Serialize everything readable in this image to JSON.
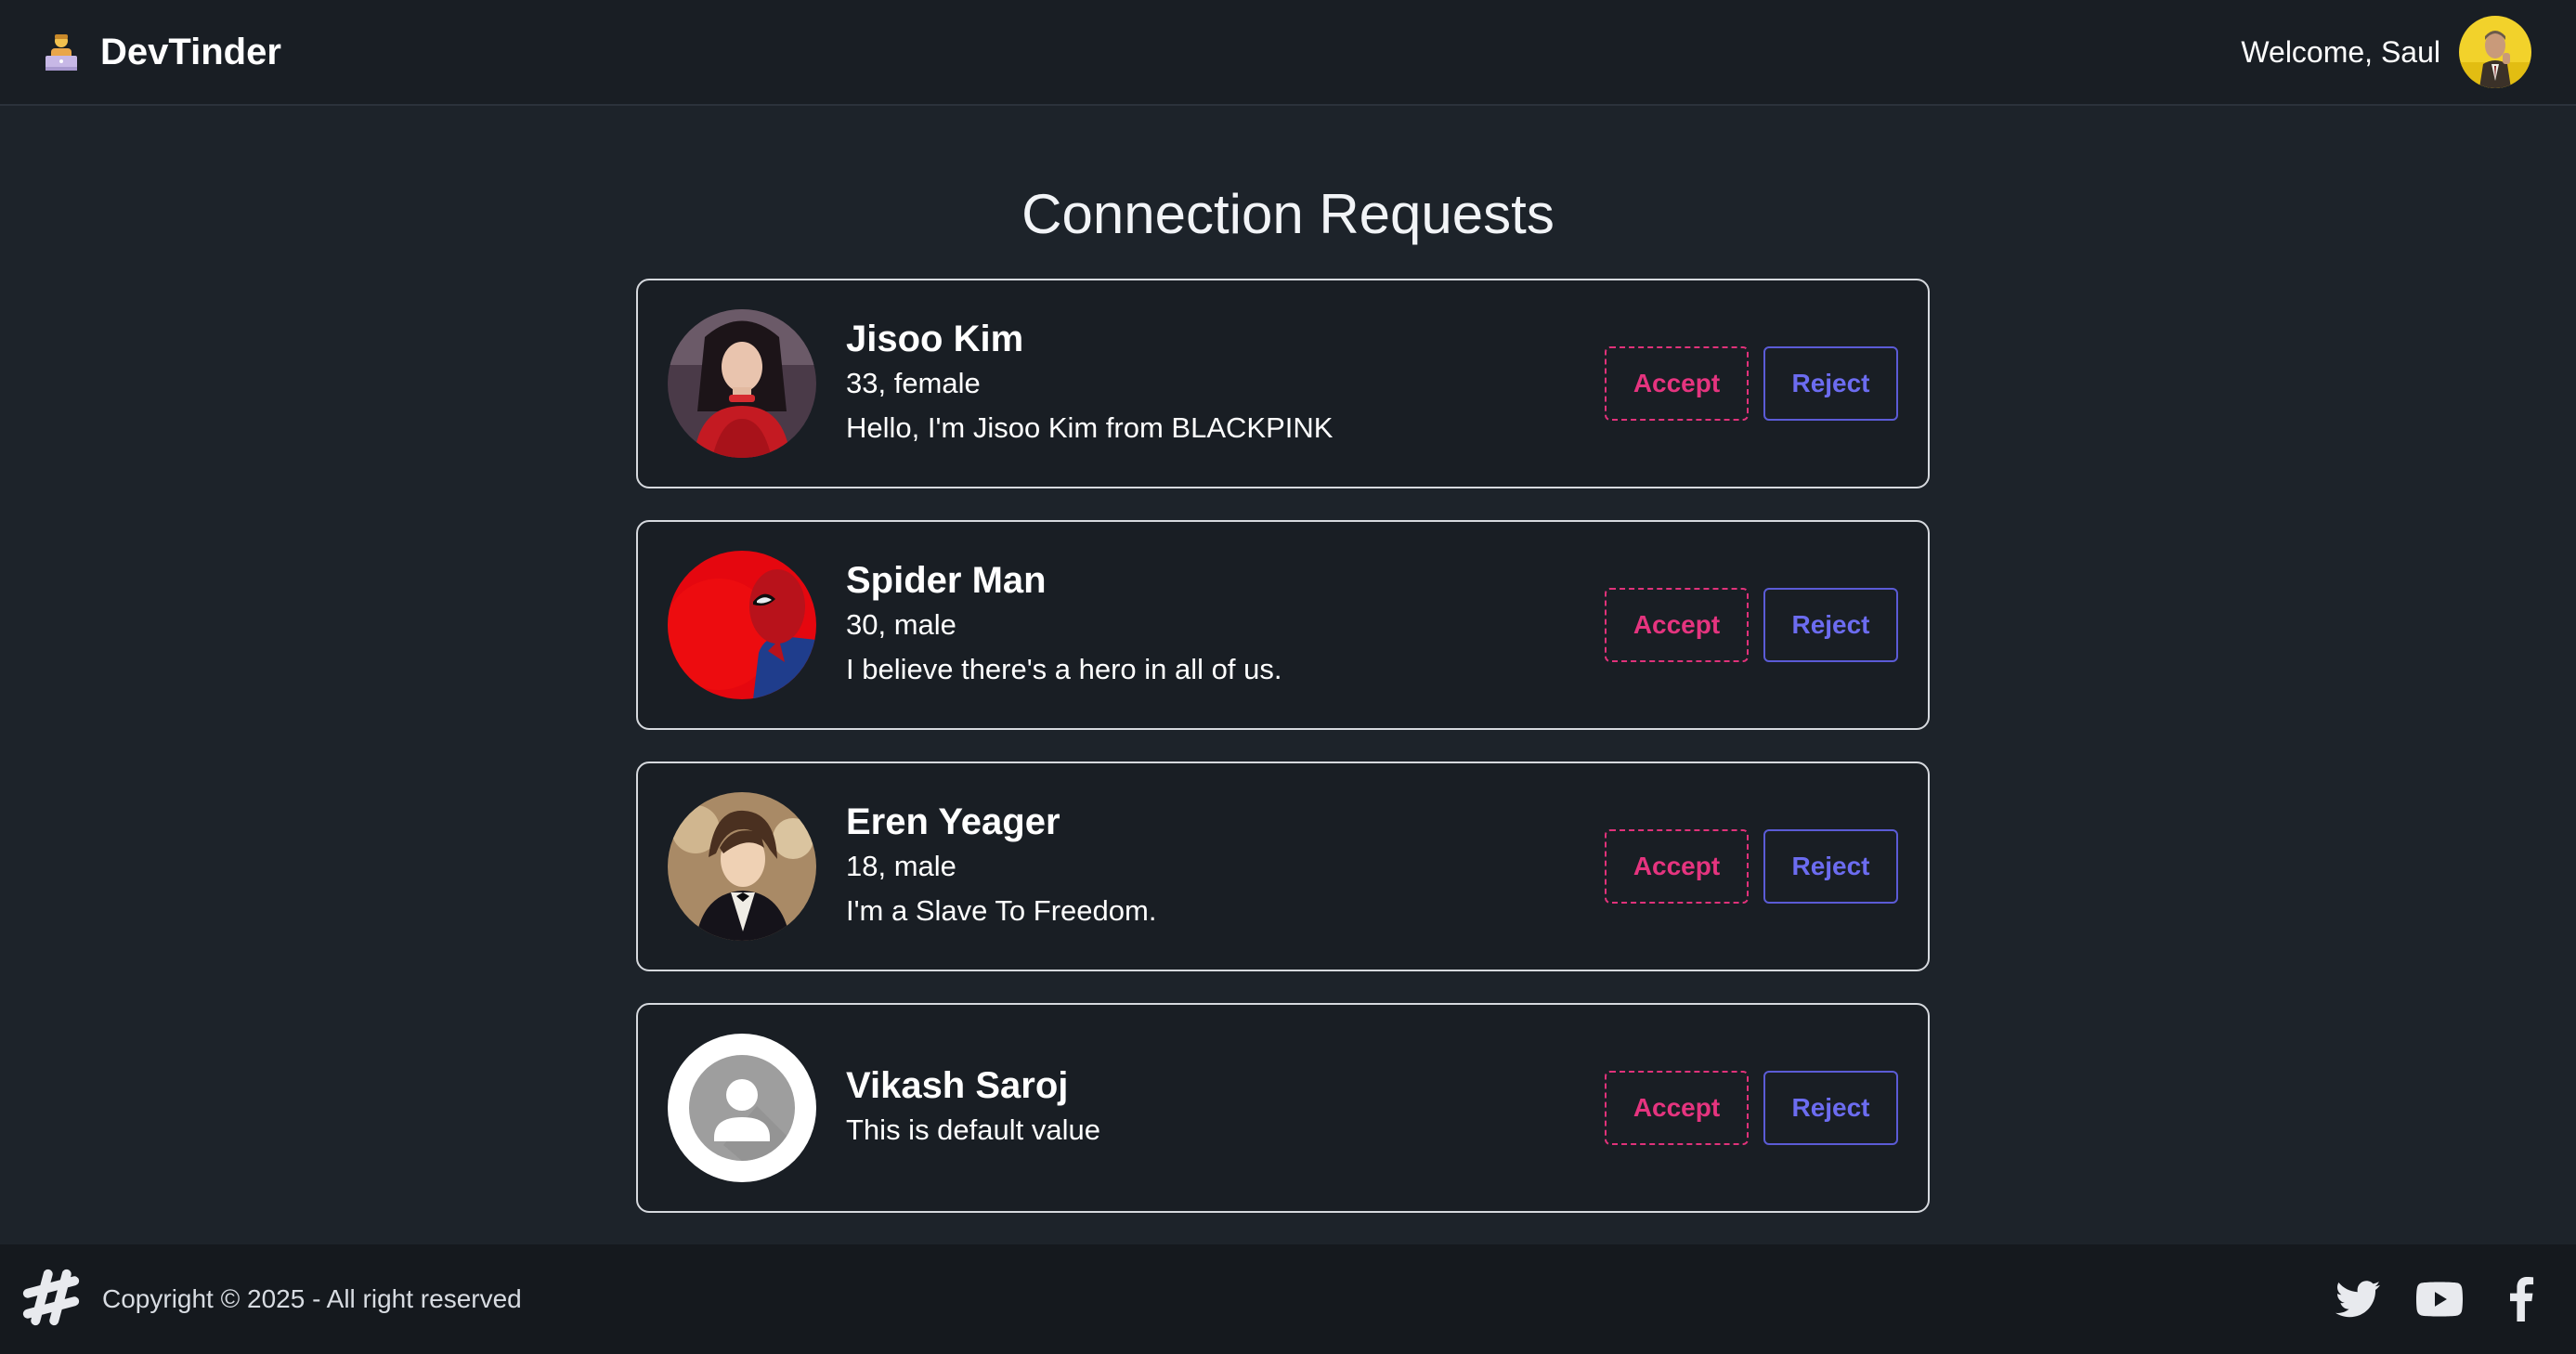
{
  "navbar": {
    "brand": "DevTinder",
    "brand_icon": "technologist-emoji-icon",
    "welcome": "Welcome, Saul"
  },
  "page": {
    "title": "Connection Requests"
  },
  "requests": [
    {
      "name": "Jisoo Kim",
      "details": "33, female",
      "about": "Hello, I'm Jisoo Kim from BLACKPINK",
      "avatar": "photo-woman-red-dress",
      "accept_label": "Accept",
      "reject_label": "Reject"
    },
    {
      "name": "Spider Man",
      "details": "30, male",
      "about": "I believe there's a hero in all of us.",
      "avatar": "photo-spiderman-red",
      "accept_label": "Accept",
      "reject_label": "Reject"
    },
    {
      "name": "Eren Yeager",
      "details": "18, male",
      "about": "I'm a Slave To Freedom.",
      "avatar": "photo-anime-man-tuxedo",
      "accept_label": "Accept",
      "reject_label": "Reject"
    },
    {
      "name": "Vikash Saroj",
      "details": "This is default value",
      "about": "",
      "avatar": "default-user-icon",
      "accept_label": "Accept",
      "reject_label": "Reject"
    }
  ],
  "footer": {
    "copyright": "Copyright © 2025 - All right reserved",
    "logo_icon": "hashtag-logo-icon",
    "social": [
      "twitter-icon",
      "youtube-icon",
      "facebook-icon"
    ]
  },
  "colors": {
    "background": "#1d232a",
    "navbar": "#191e24",
    "card_border": "#d6d9de",
    "accept": "#e5347f",
    "reject": "#6c6cf0"
  }
}
